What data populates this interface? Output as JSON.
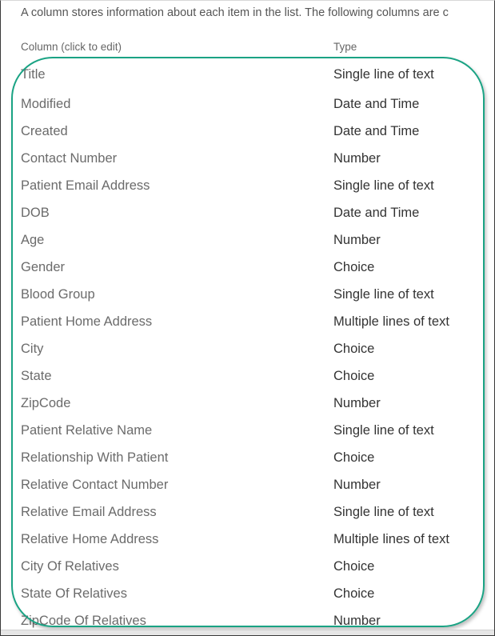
{
  "intro_text": "A column stores information about each item in the list. The following columns are c",
  "table": {
    "headers": {
      "column": "Column (click to edit)",
      "type": "Type"
    },
    "rows": [
      {
        "name": "Title",
        "type": "Single line of text"
      },
      {
        "name": "Modified",
        "type": "Date and Time"
      },
      {
        "name": "Created",
        "type": "Date and Time"
      },
      {
        "name": "Contact Number",
        "type": "Number"
      },
      {
        "name": "Patient Email Address",
        "type": "Single line of text"
      },
      {
        "name": "DOB",
        "type": "Date and Time"
      },
      {
        "name": "Age",
        "type": "Number"
      },
      {
        "name": "Gender",
        "type": "Choice"
      },
      {
        "name": "Blood Group",
        "type": "Single line of text"
      },
      {
        "name": "Patient Home Address",
        "type": "Multiple lines of text"
      },
      {
        "name": "City",
        "type": "Choice"
      },
      {
        "name": "State",
        "type": "Choice"
      },
      {
        "name": "ZipCode",
        "type": "Number"
      },
      {
        "name": "Patient Relative Name",
        "type": "Single line of text"
      },
      {
        "name": "Relationship With Patient",
        "type": "Choice"
      },
      {
        "name": "Relative Contact Number",
        "type": "Number"
      },
      {
        "name": "Relative Email Address",
        "type": "Single line of text"
      },
      {
        "name": "Relative Home Address",
        "type": "Multiple lines of text"
      },
      {
        "name": "City Of Relatives",
        "type": "Choice"
      },
      {
        "name": "State Of Relatives",
        "type": "Choice"
      },
      {
        "name": "ZipCode Of Relatives",
        "type": "Number"
      }
    ]
  },
  "colors": {
    "highlight": "#1aa384",
    "column_name_text": "#6b6b6b",
    "type_text": "#333333"
  }
}
